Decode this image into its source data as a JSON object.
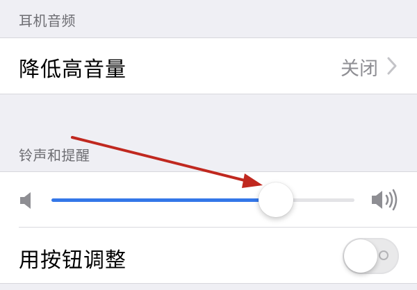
{
  "headphone_section": {
    "header": "耳机音频",
    "reduce_loud_audio": {
      "label": "降低高音量",
      "value": "关闭"
    }
  },
  "ringer_section": {
    "header": "铃声和提醒",
    "volume_level": 0.74,
    "change_with_buttons": {
      "label": "用按钮调整",
      "enabled": false
    }
  },
  "annotation": {
    "arrow_color": "#c0281f"
  },
  "colors": {
    "background": "#efeff4",
    "slider_fill": "#3477e8",
    "secondary_text": "#8e8e93"
  },
  "icons": [
    "chevron-right-icon",
    "speaker-low-icon",
    "speaker-high-icon"
  ]
}
